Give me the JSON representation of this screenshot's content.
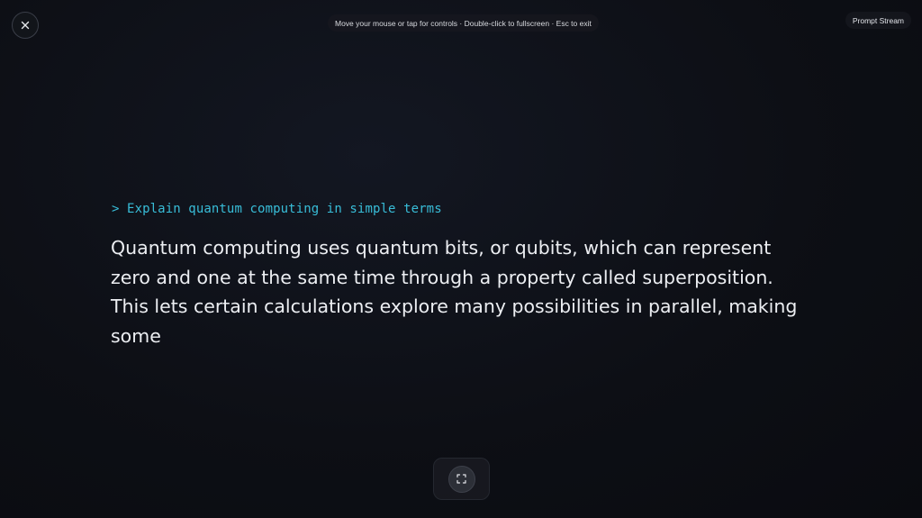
{
  "header": {
    "close_icon": "close-icon",
    "hint_text": "Move your mouse or tap for controls · Double-click to fullscreen · Esc to exit",
    "app_title": "Prompt Stream"
  },
  "content": {
    "prompt": "> Explain quantum computing in simple terms",
    "response": "Quantum computing uses quantum bits, or qubits, which can represent zero and one at the same time through a property called superposition. This lets certain calculations explore many possibilities in parallel, making some"
  },
  "controls": {
    "fullscreen_icon": "fullscreen-icon"
  },
  "colors": {
    "background": "#0d0f15",
    "prompt_accent": "#38bdd8",
    "text": "#eceef2"
  }
}
